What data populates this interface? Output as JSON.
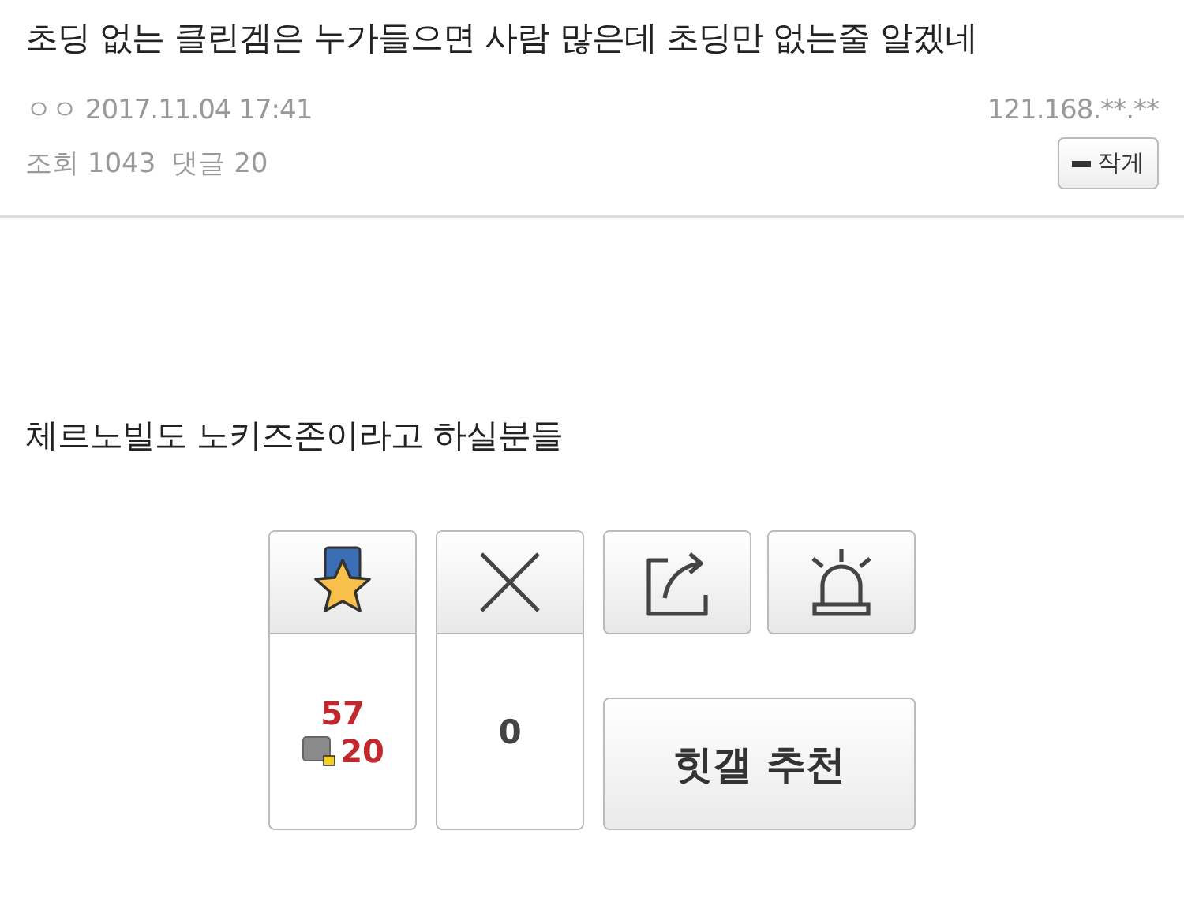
{
  "post": {
    "title": "초딩 없는 클린겜은 누가들으면 사람 많은데 초딩만 없는줄 알겠네",
    "author": "ㅇㅇ",
    "date": "2017.11.04 17:41",
    "ip": "121.168.**.**",
    "views_label": "조회",
    "views": "1043",
    "comments_label": "댓글",
    "comments": "20",
    "font_button": "작게",
    "body": "체르노빌도 노키즈존이라고 하실분들"
  },
  "actions": {
    "upvotes": "57",
    "fixed_upvotes": "20",
    "downvotes": "0",
    "hit_button": "힛갤 추천"
  }
}
